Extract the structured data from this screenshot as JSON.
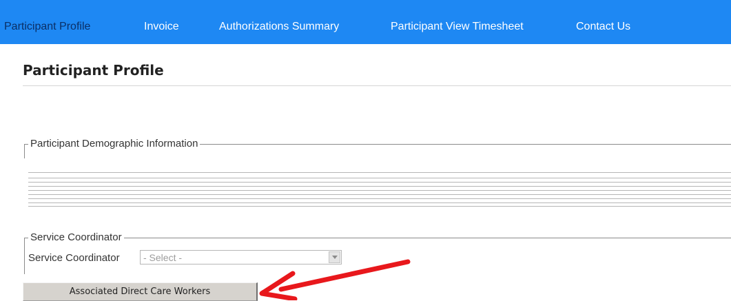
{
  "nav": {
    "items": [
      {
        "label": "Participant Profile",
        "active": true
      },
      {
        "label": "Invoice",
        "active": false
      },
      {
        "label": "Authorizations Summary",
        "active": false
      },
      {
        "label": "Participant View Timesheet",
        "active": false
      },
      {
        "label": "Contact Us",
        "active": false
      }
    ]
  },
  "page": {
    "title": "Participant Profile"
  },
  "demographics": {
    "legend": "Participant Demographic Information"
  },
  "service_coordinator": {
    "legend": "Service Coordinator",
    "label": "Service Coordinator",
    "select_value": "- Select -"
  },
  "actions": {
    "associated_workers_label": "Associated Direct Care Workers"
  },
  "colors": {
    "nav_background": "#1e88f3",
    "nav_active_text": "#0b2f66",
    "annotation_arrow": "#e8181c"
  },
  "icons": {
    "select_arrow": "chevron-down-icon",
    "annotation": "red-arrow-icon"
  }
}
